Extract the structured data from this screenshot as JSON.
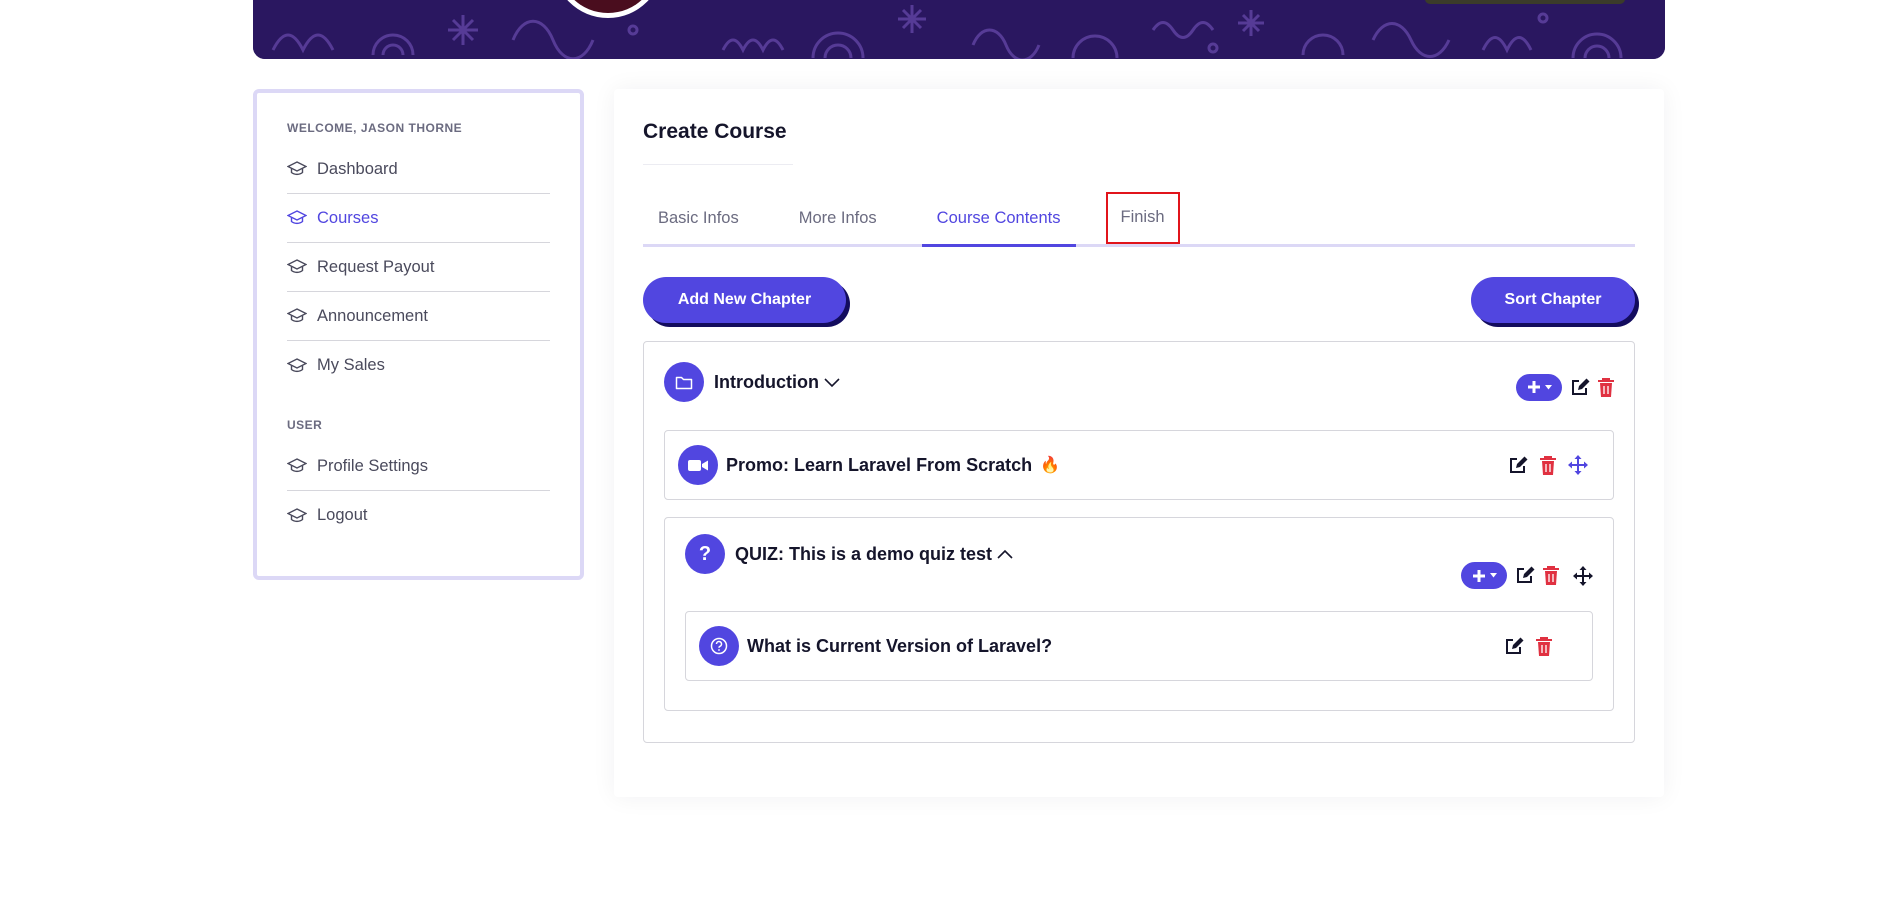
{
  "sidebar": {
    "welcome_heading": "WELCOME, JASON THORNE",
    "items": [
      {
        "label": "Dashboard",
        "active": false
      },
      {
        "label": "Courses",
        "active": true
      },
      {
        "label": "Request Payout",
        "active": false
      },
      {
        "label": "Announcement",
        "active": false
      },
      {
        "label": "My Sales",
        "active": false
      }
    ],
    "user_heading": "USER",
    "user_items": [
      {
        "label": "Profile Settings"
      },
      {
        "label": "Logout"
      }
    ]
  },
  "main": {
    "title": "Create Course",
    "tabs": [
      {
        "label": "Basic Infos"
      },
      {
        "label": "More Infos"
      },
      {
        "label": "Course Contents",
        "active": true
      },
      {
        "label": "Finish",
        "highlighted": true
      }
    ],
    "add_chapter_label": "Add New Chapter",
    "sort_chapter_label": "Sort Chapter",
    "chapter": {
      "title": "Introduction",
      "lesson": {
        "title": "Promo: Learn Laravel From Scratch",
        "emoji": "🔥"
      },
      "quiz": {
        "title": "QUIZ: This is a demo quiz test",
        "question": {
          "title": "What is Current Version of Laravel?"
        }
      }
    }
  },
  "colors": {
    "accent": "#5146e0",
    "accent_shadow": "#130c5e",
    "danger": "#e03141",
    "highlight_box": "#e1141b",
    "banner": "#2a1760"
  }
}
